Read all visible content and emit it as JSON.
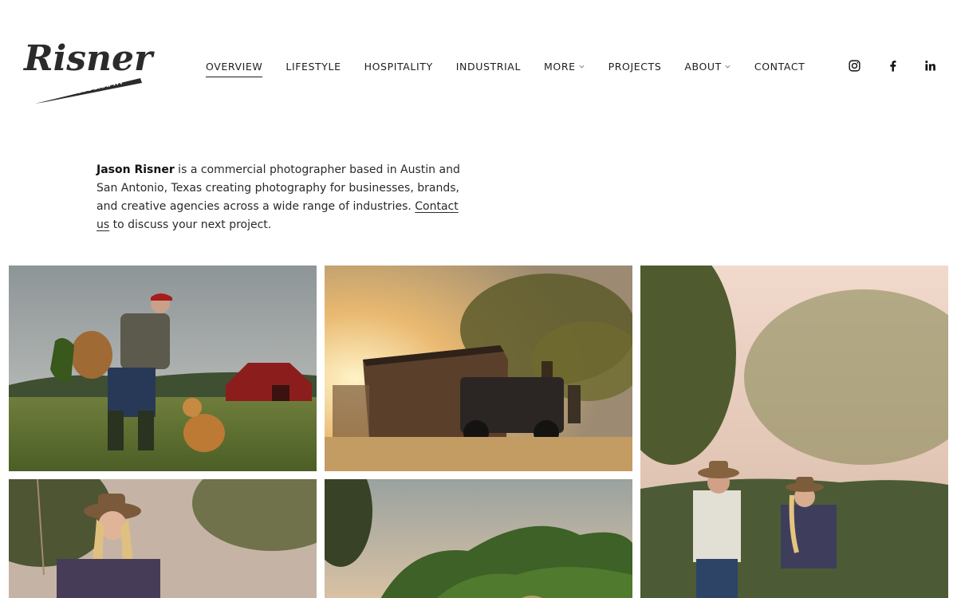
{
  "brand": {
    "logo_text": "Risner",
    "logo_subtext": "PHOTOGRAPHY"
  },
  "nav": {
    "items": [
      {
        "label": "OVERVIEW",
        "active": true
      },
      {
        "label": "LIFESTYLE"
      },
      {
        "label": "HOSPITALITY"
      },
      {
        "label": "INDUSTRIAL"
      },
      {
        "label": "MORE",
        "dropdown": true
      },
      {
        "label": "PROJECTS"
      },
      {
        "label": "ABOUT",
        "dropdown": true
      },
      {
        "label": "CONTACT"
      }
    ]
  },
  "social": {
    "icons": [
      "instagram-icon",
      "facebook-icon",
      "linkedin-icon"
    ]
  },
  "intro": {
    "name": "Jason Risner",
    "text_1": " is a commercial photographer based in Austin and San Antonio, Texas creating photography for businesses, brands, and creative agencies across a wide range of industries. ",
    "link": "Contact us",
    "text_2": " to discuss your next project."
  },
  "colors": {
    "text": "#1e1e1e",
    "background": "#ffffff"
  }
}
